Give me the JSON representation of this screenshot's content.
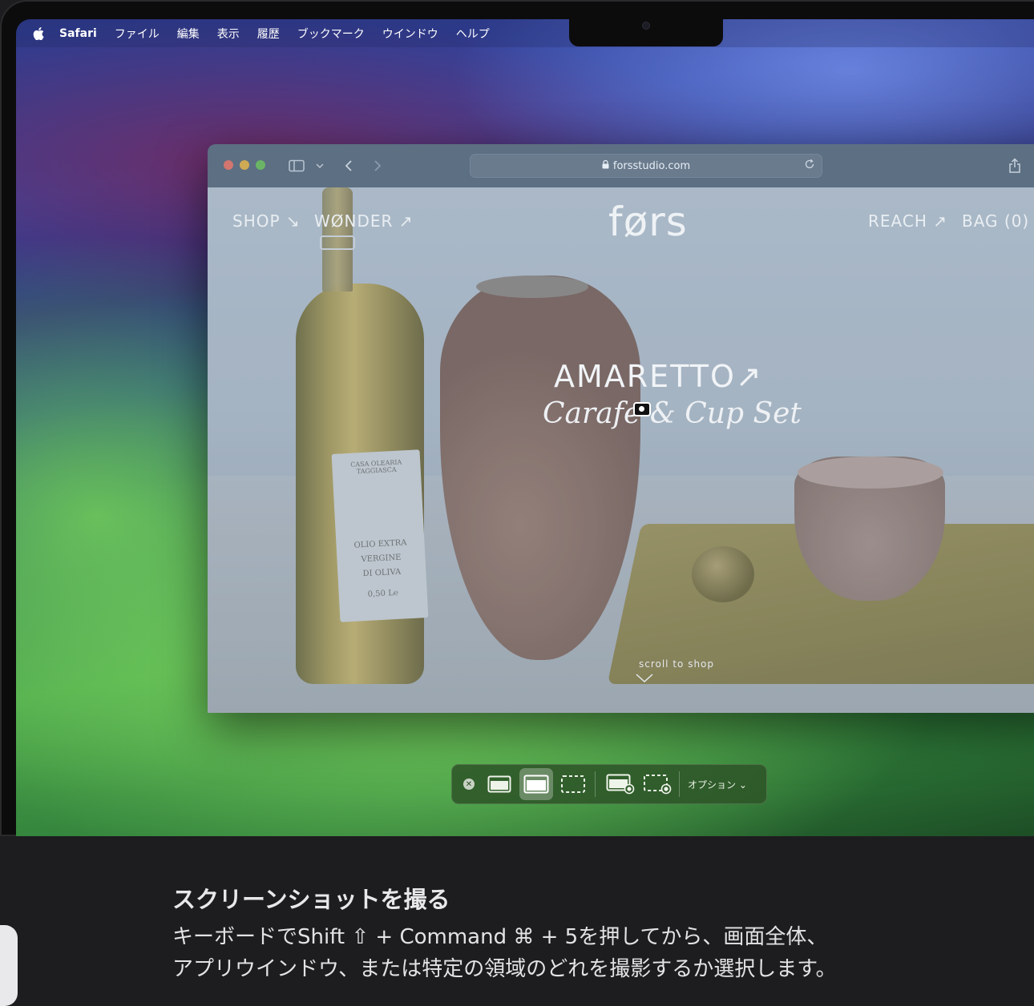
{
  "menubar": {
    "app_name": "Safari",
    "items": [
      "ファイル",
      "編集",
      "表示",
      "履歴",
      "ブックマーク",
      "ウインドウ",
      "ヘルプ"
    ]
  },
  "browser": {
    "url": "forsstudio.com",
    "icons": [
      "sidebar-icon",
      "chevron-down-icon",
      "back-icon",
      "forward-icon",
      "lock-icon",
      "reload-icon",
      "share-icon",
      "new-tab-icon"
    ]
  },
  "site": {
    "nav_left": [
      "SHOP ↘",
      "WØNDER ↗"
    ],
    "logo": "førs",
    "nav_right": [
      "REACH ↗",
      "BAG (0)"
    ],
    "hero_title": "AMARETTO↗",
    "hero_subtitle": "Carafe & Cup Set",
    "scroll_hint": "scroll to shop",
    "bottle_label": [
      "CASA OLEARIA TAGGIASCA",
      "OLIO EXTRA",
      "VERGINE",
      "DI OLIVA",
      "0,50 L℮"
    ]
  },
  "screenshot_toolbar": {
    "options_label": "オプション",
    "tools": [
      "capture-entire-screen",
      "capture-selected-window",
      "capture-selected-portion",
      "record-entire-screen",
      "record-selected-portion"
    ],
    "selected_tool": "capture-selected-window"
  },
  "caption": {
    "title": "スクリーンショットを撮る",
    "body_line1": "キーボードでShift ⇧ + Command ⌘ + 5を押してから、画面全体、",
    "body_line2": "アプリウインドウ、または特定の領域のどれを撮影するか選択します。"
  },
  "side_tab": {
    "glyph": "〈"
  }
}
